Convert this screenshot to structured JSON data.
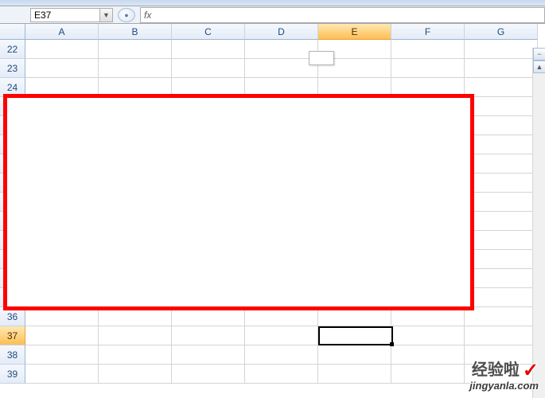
{
  "name_box": {
    "value": "E37"
  },
  "formula_bar": {
    "fx_label": "fx",
    "value": ""
  },
  "columns": [
    "A",
    "B",
    "C",
    "D",
    "E",
    "F",
    "G"
  ],
  "active_column_index": 4,
  "row_start": 22,
  "row_end": 39,
  "active_row": 37,
  "watermark": {
    "line1": "经验啦",
    "line2": "jingyanla.com"
  }
}
